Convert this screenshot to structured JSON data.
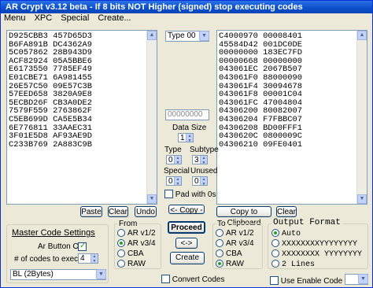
{
  "window": {
    "title": "AR Crypt v3.12 beta - If 8 bits NOT Higher (signed) stop executing codes"
  },
  "menu": [
    "Menu",
    "XPC",
    "Special",
    "Create..."
  ],
  "left_codes": [
    "D925CBB3 457D65D3",
    "B6FA891B DC4362A9",
    "5C057862 28B943D9",
    "ACF82924 05A5BBE6",
    "E6173550 7785EF49",
    "E01CBE71 6A981455",
    "26E57C50 09E57C3B",
    "57EED658 3820A9E8",
    "5ECBD26F CB3A0DE2",
    "7579F559 2763862F",
    "C5EB699D CA5E5B34",
    "6E776811 33AAEC31",
    "3F01E5D8 AF93AE9D",
    "C233B769 2A883C9B"
  ],
  "right_codes": [
    "C4000970 00008401",
    "45584D42 001DC0DE",
    "00000000 183EC7FD",
    "00000668 00000000",
    "043061EC 2067B507",
    "043061F0 88000090",
    "043061F4 30094678",
    "043061F8 00001C04",
    "043061FC 47004804",
    "04306200 80082007",
    "04306204 F7FBBC07",
    "04306208 BD00FFF1",
    "0430620C 0800009C",
    "04306210 09FE0401"
  ],
  "type_combo": "Type 00",
  "key_field": "00000000",
  "data_size": {
    "label": "Data Size",
    "value": "1"
  },
  "type": {
    "label": "Type",
    "value": "0"
  },
  "subtype": {
    "label": "Subtype",
    "value": "3"
  },
  "special": {
    "label": "Special",
    "value": "0"
  },
  "unused": {
    "label": "Unused",
    "value": "0"
  },
  "pad_with_0s": "Pad with 0s",
  "buttons": {
    "paste": "Paste",
    "clear_left": "Clear",
    "undo": "Undo",
    "copy": "<- Copy -",
    "copy_clipboard": "Copy to Clipboard",
    "clear_right": "Clear",
    "proceed": "Proceed",
    "swap": "<->",
    "create": "Create"
  },
  "master": {
    "title": "Master Code Settings",
    "ar_button_label": "Ar Button On",
    "codes_label": "# of codes to execute",
    "codes_value": "4",
    "bl_value": "BL  (2Bytes)"
  },
  "from": {
    "title": "From",
    "options": [
      "AR v1/2",
      "AR v3/4",
      "CBA",
      "RAW"
    ],
    "selected": 1
  },
  "to": {
    "title": "To",
    "options": [
      "AR v1/2",
      "AR v3/4",
      "CBA",
      "RAW"
    ],
    "selected": 3
  },
  "output": {
    "title": "Output Format",
    "options": [
      "Auto",
      "XXXXXXXXYYYYYYYY",
      "XXXXXXXX YYYYYYYY",
      "2 Lines"
    ],
    "selected": 0
  },
  "convert_codes": "Convert Codes",
  "use_enable_code": "Use Enable Code"
}
